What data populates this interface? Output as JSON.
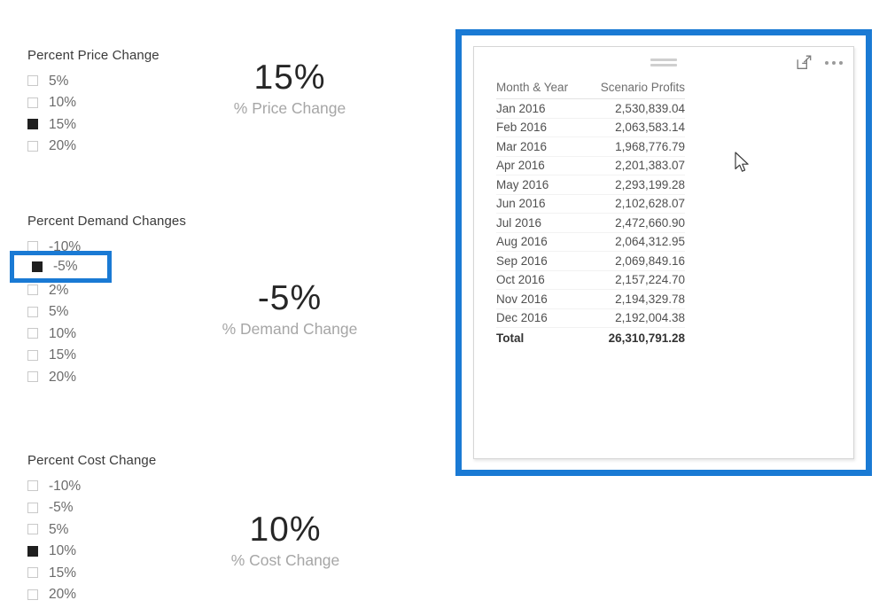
{
  "slicers": [
    {
      "id": "price",
      "title": "Percent Price Change",
      "items": [
        {
          "label": "5%",
          "checked": false
        },
        {
          "label": "10%",
          "checked": false
        },
        {
          "label": "15%",
          "checked": true
        },
        {
          "label": "20%",
          "checked": false
        }
      ]
    },
    {
      "id": "demand",
      "title": "Percent Demand Changes",
      "items": [
        {
          "label": "-10%",
          "checked": false
        },
        {
          "label": "-5%",
          "checked": true
        },
        {
          "label": "2%",
          "checked": false
        },
        {
          "label": "5%",
          "checked": false
        },
        {
          "label": "10%",
          "checked": false
        },
        {
          "label": "15%",
          "checked": false
        },
        {
          "label": "20%",
          "checked": false
        }
      ]
    },
    {
      "id": "cost",
      "title": "Percent Cost Change",
      "items": [
        {
          "label": "-10%",
          "checked": false
        },
        {
          "label": "-5%",
          "checked": false
        },
        {
          "label": "5%",
          "checked": false
        },
        {
          "label": "10%",
          "checked": true
        },
        {
          "label": "15%",
          "checked": false
        },
        {
          "label": "20%",
          "checked": false
        }
      ]
    }
  ],
  "cards": [
    {
      "id": "price",
      "value": "15%",
      "label": "% Price Change"
    },
    {
      "id": "demand",
      "value": "-5%",
      "label": "% Demand Change"
    },
    {
      "id": "cost",
      "value": "10%",
      "label": "% Cost Change"
    }
  ],
  "table_panel": {
    "header_icons": {
      "focus": "focus-mode-icon",
      "more": "more-options-icon",
      "drag": "drag-handle-icon"
    },
    "columns": [
      "Month & Year",
      "Scenario Profits"
    ],
    "rows": [
      {
        "month": "Jan 2016",
        "value": "2,530,839.04"
      },
      {
        "month": "Feb 2016",
        "value": "2,063,583.14"
      },
      {
        "month": "Mar 2016",
        "value": "1,968,776.79"
      },
      {
        "month": "Apr 2016",
        "value": "2,201,383.07"
      },
      {
        "month": "May 2016",
        "value": "2,293,199.28"
      },
      {
        "month": "Jun 2016",
        "value": "2,102,628.07"
      },
      {
        "month": "Jul 2016",
        "value": "2,472,660.90"
      },
      {
        "month": "Aug 2016",
        "value": "2,064,312.95"
      },
      {
        "month": "Sep 2016",
        "value": "2,069,849.16"
      },
      {
        "month": "Oct 2016",
        "value": "2,157,224.70"
      },
      {
        "month": "Nov 2016",
        "value": "2,194,329.78"
      },
      {
        "month": "Dec 2016",
        "value": "2,192,004.38"
      }
    ],
    "total": {
      "month": "Total",
      "value": "26,310,791.28"
    }
  },
  "annotations": {
    "highlight_color": "#1a7ad4",
    "demand_selected_label": "-5%"
  },
  "chart_data": {
    "type": "table",
    "title": "Scenario Profits by Month & Year",
    "columns": [
      "Month & Year",
      "Scenario Profits"
    ],
    "categories": [
      "Jan 2016",
      "Feb 2016",
      "Mar 2016",
      "Apr 2016",
      "May 2016",
      "Jun 2016",
      "Jul 2016",
      "Aug 2016",
      "Sep 2016",
      "Oct 2016",
      "Nov 2016",
      "Dec 2016"
    ],
    "values": [
      2530839.04,
      2063583.14,
      1968776.79,
      2201383.07,
      2293199.28,
      2102628.07,
      2472660.9,
      2064312.95,
      2069849.16,
      2157224.7,
      2194329.78,
      2192004.38
    ],
    "total": 26310791.28,
    "xlabel": "Month & Year",
    "ylabel": "Scenario Profits"
  }
}
